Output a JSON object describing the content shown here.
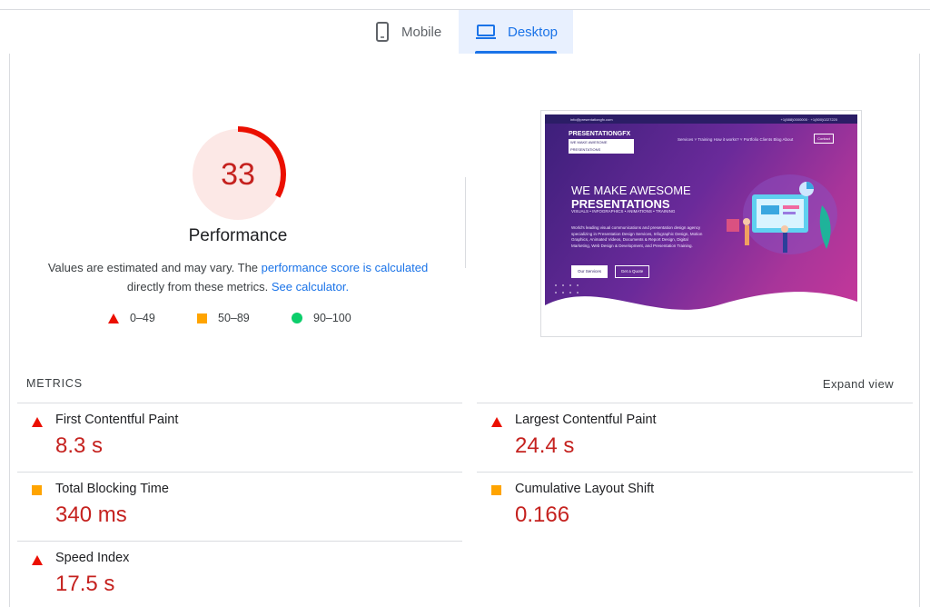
{
  "tabs": {
    "mobile": "Mobile",
    "desktop": "Desktop"
  },
  "score": {
    "value": "33",
    "fraction": 0.33,
    "title": "Performance",
    "desc_prefix": "Values are estimated and may vary. The ",
    "desc_link1": "performance score is calculated",
    "desc_middle": " directly from these metrics. ",
    "desc_link2": "See calculator."
  },
  "legend": {
    "fail": "0–49",
    "average": "50–89",
    "pass": "90–100"
  },
  "screenshot": {
    "topbar_left": "info@presentationgfx.com",
    "topbar_right": "+1(888)0000000 · +1(800)0227220",
    "logo": "PRESENTATIONGFX",
    "logo_tag": "WE MAKE AWESOME PRESENTATIONS",
    "nav": "Services ˅   Training   How it works? ˅   Portfolio   Clients   Blog   About",
    "nav_button": "Contact",
    "headline1": "WE MAKE AWESOME",
    "headline2": "PRESENTATIONS",
    "tagline": "VISUALS • INFOGRAPHICS • ANIMATIONS • TRAINING",
    "paragraph": "World's leading visual communications and presentation design agency specializing in Presentation Design Services, Infographic Design, Motion Graphics, Animated Videos, Documents & Report Design, Digital Marketing, Web Design & Development, and Presentation Training.",
    "button1": "Our Services",
    "button2": "Get a Quote"
  },
  "metrics": {
    "heading": "METRICS",
    "expand": "Expand view",
    "items": [
      {
        "label": "First Contentful Paint",
        "value": "8.3 s",
        "rating": "fail"
      },
      {
        "label": "Largest Contentful Paint",
        "value": "24.4 s",
        "rating": "fail"
      },
      {
        "label": "Total Blocking Time",
        "value": "340 ms",
        "rating": "average"
      },
      {
        "label": "Cumulative Layout Shift",
        "value": "0.166",
        "rating": "average"
      },
      {
        "label": "Speed Index",
        "value": "17.5 s",
        "rating": "fail"
      }
    ]
  },
  "colors": {
    "fail": "#eb0f00",
    "average": "#ffa400",
    "pass": "#0cce6b",
    "fail_text": "#c5221f",
    "accent": "#1a73e8"
  }
}
